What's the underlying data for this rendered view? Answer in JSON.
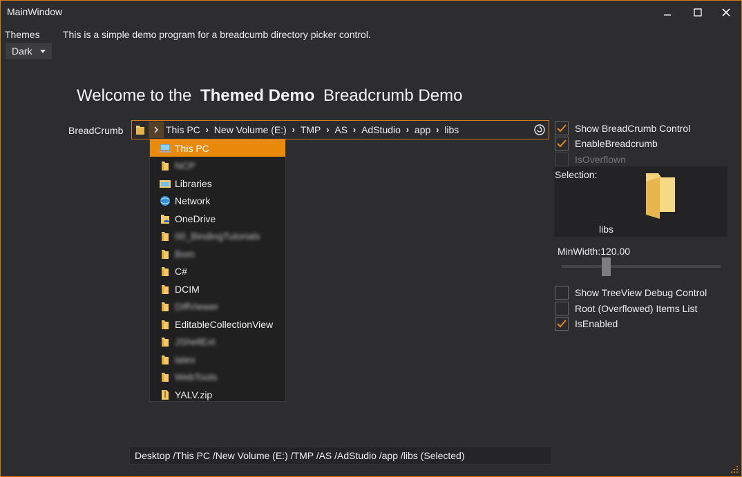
{
  "window": {
    "title": "MainWindow"
  },
  "themes": {
    "label": "Themes",
    "selected": "Dark"
  },
  "intro_text": "This is a simple demo program for a breadcumb directory picker control.",
  "welcome": {
    "prefix": "Welcome to the",
    "bold": "Themed Demo",
    "suffix": "Breadcrumb Demo"
  },
  "breadcrumb": {
    "label": "BreadCrumb",
    "items": [
      "This PC",
      "New Volume (E:)",
      "TMP",
      "AS",
      "AdStudio",
      "app",
      "libs"
    ]
  },
  "dropdown": {
    "items": [
      {
        "label": "This PC",
        "icon": "computer-icon",
        "selected": true,
        "blurred": false
      },
      {
        "label": "NCP",
        "icon": "folder-icon",
        "selected": false,
        "blurred": true
      },
      {
        "label": "Libraries",
        "icon": "libraries-icon",
        "selected": false,
        "blurred": false
      },
      {
        "label": "Network",
        "icon": "network-icon",
        "selected": false,
        "blurred": false
      },
      {
        "label": "OneDrive",
        "icon": "onedrive-icon",
        "selected": false,
        "blurred": false
      },
      {
        "label": "00_BindingTutorials",
        "icon": "folder-icon",
        "selected": false,
        "blurred": true
      },
      {
        "label": "Bom",
        "icon": "folder-icon",
        "selected": false,
        "blurred": true
      },
      {
        "label": "C#",
        "icon": "folder-icon",
        "selected": false,
        "blurred": false
      },
      {
        "label": "DCIM",
        "icon": "folder-icon",
        "selected": false,
        "blurred": false
      },
      {
        "label": "DiffViewer",
        "icon": "folder-icon",
        "selected": false,
        "blurred": true
      },
      {
        "label": "EditableCollectionView",
        "icon": "folder-icon",
        "selected": false,
        "blurred": false
      },
      {
        "label": "JShellExt",
        "icon": "folder-icon",
        "selected": false,
        "blurred": true
      },
      {
        "label": "latex",
        "icon": "folder-icon",
        "selected": false,
        "blurred": true
      },
      {
        "label": "WebTools",
        "icon": "folder-icon",
        "selected": false,
        "blurred": true
      },
      {
        "label": "YALV.zip",
        "icon": "zip-icon",
        "selected": false,
        "blurred": false
      }
    ]
  },
  "options": {
    "show_breadcrumb": {
      "label": "Show BreadCrumb Control",
      "checked": true,
      "enabled": true
    },
    "enable_breadcrumb": {
      "label": "EnableBreadcrumb",
      "checked": true,
      "enabled": true
    },
    "is_overflown": {
      "label": "IsOverflown",
      "checked": false,
      "enabled": false
    },
    "show_treeview": {
      "label": "Show TreeView Debug Control",
      "checked": false,
      "enabled": true
    },
    "root_items": {
      "label": "Root (Overflowed) Items List",
      "checked": false,
      "enabled": true
    },
    "is_enabled": {
      "label": "IsEnabled",
      "checked": true,
      "enabled": true
    }
  },
  "selection": {
    "label": "Selection:",
    "name": "libs"
  },
  "min_width": {
    "label": "MinWidth:120.00",
    "value": 120.0
  },
  "status": "Desktop /This PC /New Volume (E:) /TMP /AS /AdStudio /app /libs (Selected)",
  "colors": {
    "accent": "#e98a0b",
    "border": "#d17b1c",
    "background": "#2d2d30"
  }
}
